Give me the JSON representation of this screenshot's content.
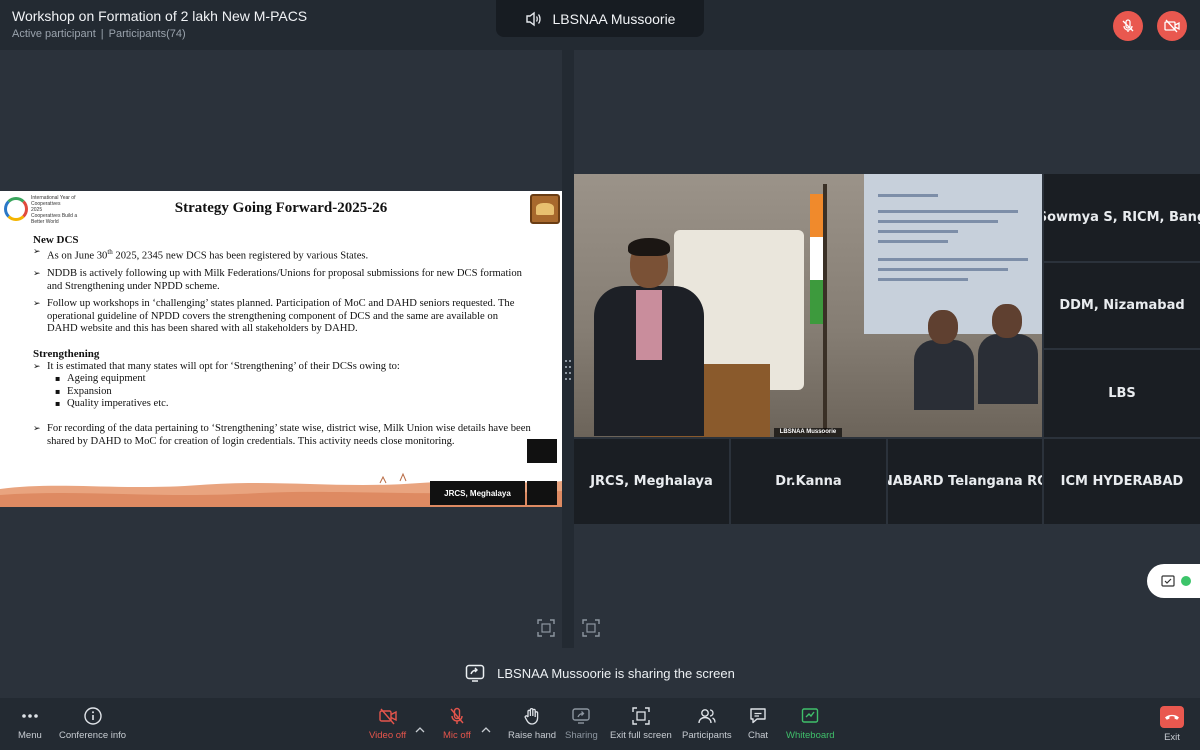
{
  "header": {
    "meeting_title": "Workshop on Formation of 2 lakh New M-PACS",
    "status": "Active participant",
    "participants": "Participants(74)",
    "speaker_icon": "speaker-icon",
    "speaker_name": "LBSNAA Mussoorie",
    "mic_icon": "mic-off-icon",
    "video_icon": "video-off-icon"
  },
  "slide": {
    "title": "Strategy Going Forward-2025-26",
    "logo_text": "International Year of Cooperatives",
    "logo_year": "2025",
    "logo_tagline": "Cooperatives Build a Better World",
    "new_dcs_heading": "New DCS",
    "bullet_1_prefix": "As on June 30",
    "bullet_1_sup": "th",
    "bullet_1_suffix": " 2025, 2345 new DCS has been registered by various States.",
    "bullet_2": "NDDB is actively following up with Milk Federations/Unions for proposal submissions for new DCS formation and Strengthening under NPDD scheme.",
    "bullet_3": "Follow up workshops in ‘challenging’ states planned. Participation of MoC and DAHD seniors requested. The operational guideline of NPDD covers the strengthening component of DCS and the same are available on DAHD website and this has been shared with all stakeholders by DAHD.",
    "strengthening_heading": "Strengthening",
    "bullet_4": "It is estimated that many states will opt for ‘Strengthening’ of their DCSs owing to:",
    "sub_1": "Ageing equipment",
    "sub_2": "Expansion",
    "sub_3": "Quality imperatives etc.",
    "bullet_5": "For recording of the data pertaining to ‘Strengthening’ state wise, district wise, Milk Union wise details have been shared by DAHD to MoC for creation of login credentials. This activity needs close monitoring.",
    "mini_tile_label": "JRCS, Meghalaya"
  },
  "video": {
    "main_label": "LBSNAA Mussoorie",
    "tiles": [
      "Sowmya S, RICM, Bang",
      "DDM, Nizamabad",
      "LBS",
      "JRCS, Meghalaya",
      "Dr.Kanna",
      "NABARD Telangana RO",
      "ICM HYDERABAD"
    ]
  },
  "sharing_banner": {
    "icon": "screen-share-icon",
    "text": "LBSNAA Mussoorie is sharing the screen"
  },
  "toolbar": {
    "menu": "Menu",
    "conference_info": "Conference info",
    "video_off": "Video off",
    "mic_off": "Mic off",
    "raise_hand": "Raise hand",
    "sharing": "Sharing",
    "exit_full_screen": "Exit full screen",
    "participants": "Participants",
    "chat": "Chat",
    "whiteboard": "Whiteboard",
    "exit": "Exit"
  },
  "colors": {
    "accent_red": "#e9584f",
    "accent_green": "#3fbf6a",
    "background": "#2b323b",
    "toolbar": "#232a32"
  }
}
